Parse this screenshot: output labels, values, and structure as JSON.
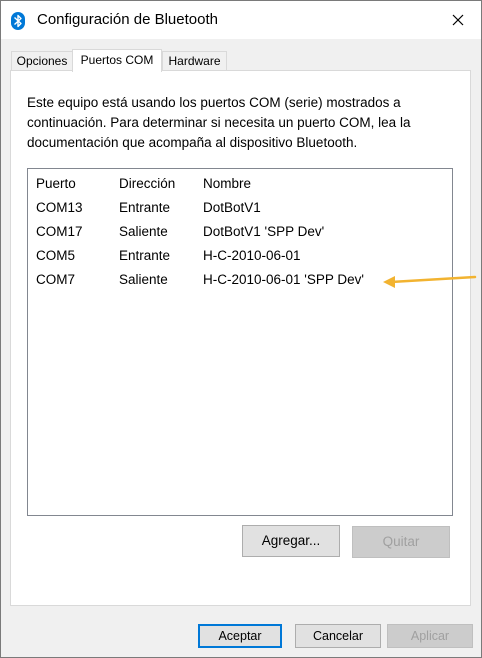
{
  "window": {
    "title": "Configuración de Bluetooth",
    "icon": "bluetooth-icon",
    "close_icon": "close-icon"
  },
  "tabs": [
    {
      "label": "Opciones",
      "active": false
    },
    {
      "label": "Puertos COM",
      "active": true
    },
    {
      "label": "Hardware",
      "active": false
    }
  ],
  "panel": {
    "description": "Este equipo está usando los puertos COM (serie) mostrados a continuación. Para determinar si necesita un puerto COM, lea la documentación que acompaña al dispositivo Bluetooth.",
    "list": {
      "columns": [
        "Puerto",
        "Dirección",
        "Nombre"
      ],
      "rows": [
        [
          "COM13",
          "Entrante",
          "DotBotV1"
        ],
        [
          "COM17",
          "Saliente",
          "DotBotV1 'SPP Dev'"
        ],
        [
          "COM5",
          "Entrante",
          "H-C-2010-06-01"
        ],
        [
          "COM7",
          "Saliente",
          "H-C-2010-06-01 'SPP Dev'"
        ]
      ]
    },
    "buttons": {
      "add": "Agregar...",
      "remove": "Quitar"
    }
  },
  "footer": {
    "ok": "Aceptar",
    "cancel": "Cancelar",
    "apply": "Aplicar"
  },
  "colors": {
    "accent": "#0078d7",
    "annotation_arrow": "#f2b330"
  }
}
